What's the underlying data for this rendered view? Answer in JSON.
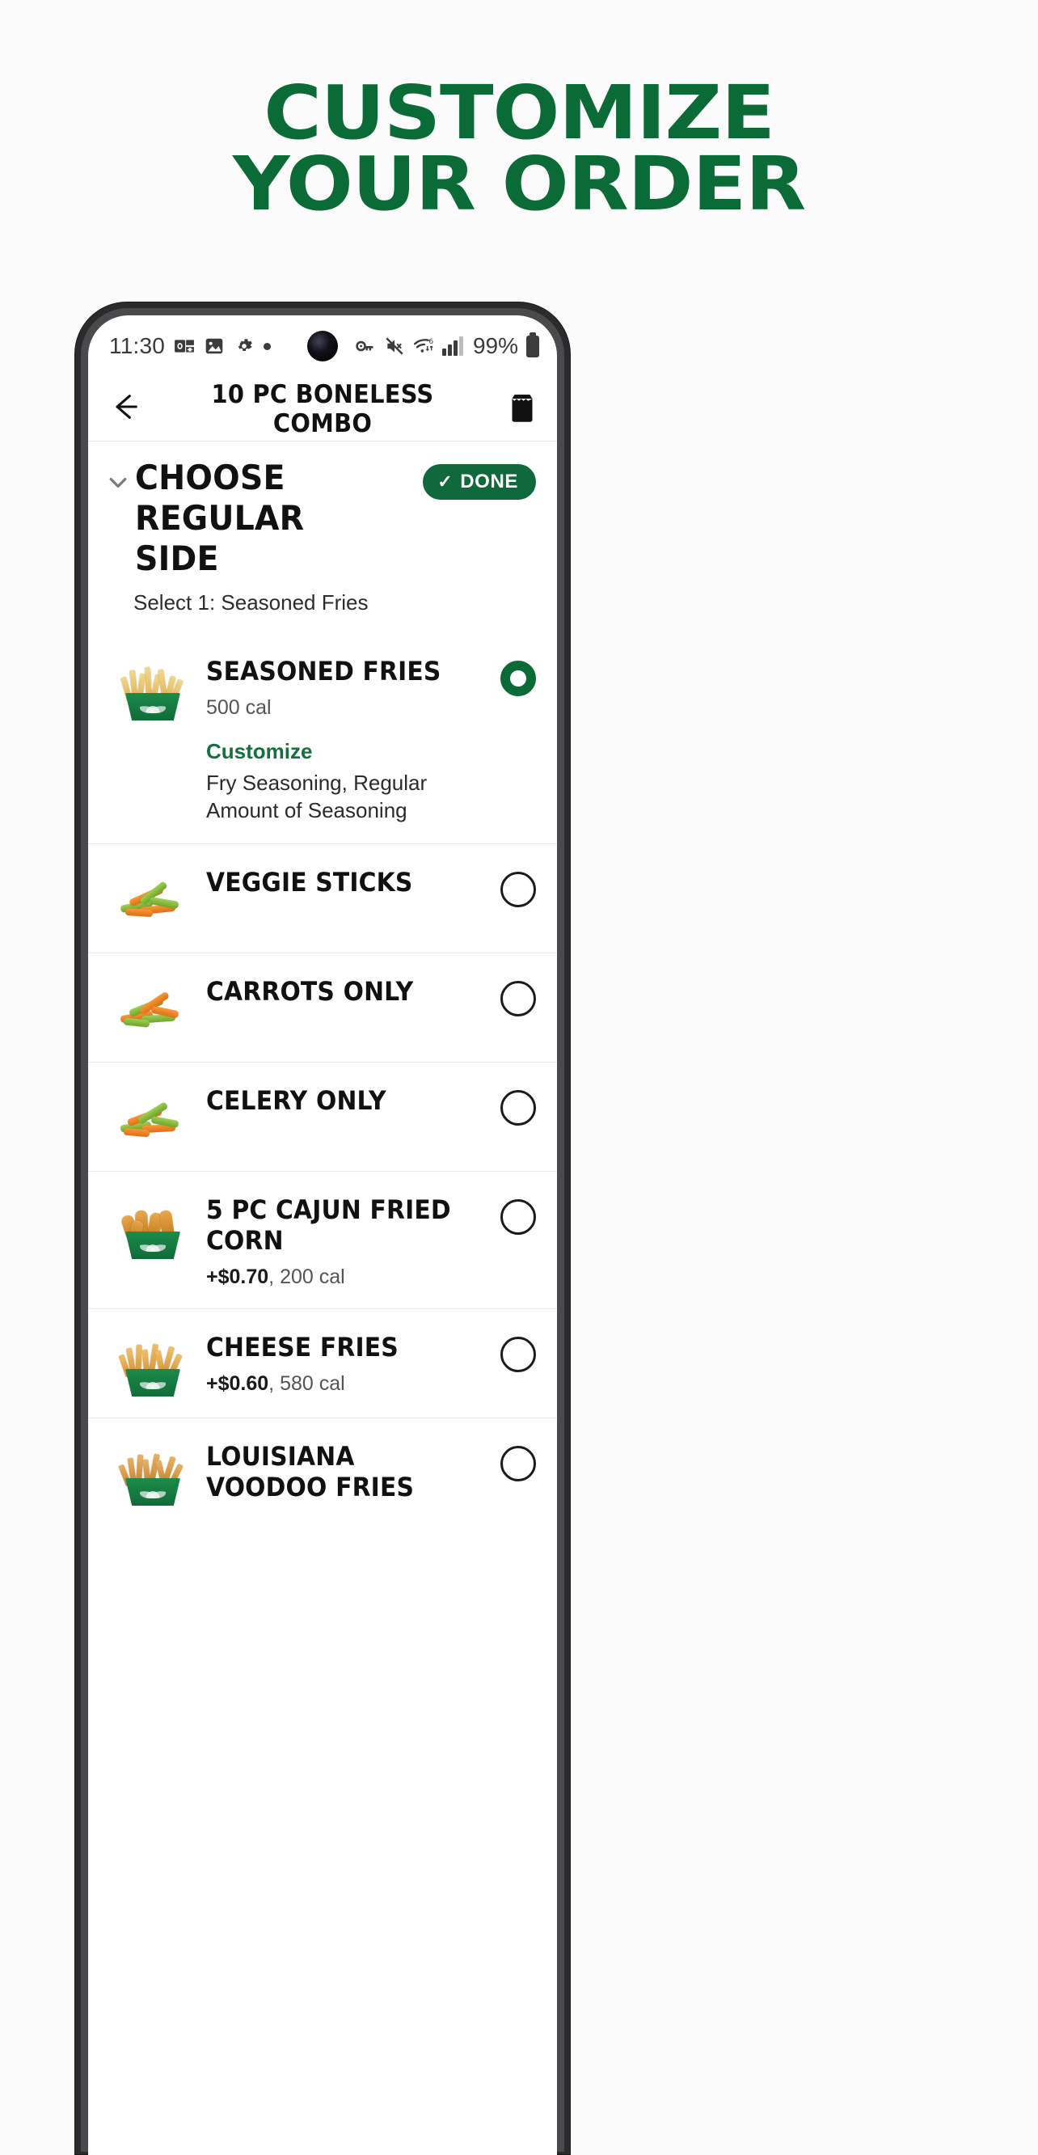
{
  "promo": {
    "line1": "CUSTOMIZE",
    "line2": "YOUR ORDER",
    "color": "#0a6b36"
  },
  "status_bar": {
    "time": "11:30",
    "icons_left": [
      "outlook-icon",
      "image-icon",
      "gear-icon",
      "dot-icon"
    ],
    "icons_right": [
      "key-icon",
      "mute-icon",
      "wifi6-icon",
      "signal-icon"
    ],
    "battery_percent": "99%"
  },
  "app_header": {
    "back_icon": "back-arrow-icon",
    "title": "10 PC BONELESS COMBO",
    "bag_icon": "shopping-bag-icon"
  },
  "section": {
    "chevron_icon": "chevron-down-icon",
    "title": "CHOOSE REGULAR SIDE",
    "done_label": "DONE",
    "done_check": "✓",
    "done_color": "#10693a",
    "select_note": "Select 1: Seasoned Fries"
  },
  "options": [
    {
      "name": "SEASONED FRIES",
      "meta_price": "",
      "meta_cal": "500 cal",
      "customize_label": "Customize",
      "customize_detail": "Fry Seasoning, Regular Amount of Seasoning",
      "selected": true,
      "thumb": "seasoned-fries-image"
    },
    {
      "name": "VEGGIE STICKS",
      "meta_price": "",
      "meta_cal": "",
      "customize_label": "",
      "customize_detail": "",
      "selected": false,
      "thumb": "veggie-sticks-image"
    },
    {
      "name": "CARROTS ONLY",
      "meta_price": "",
      "meta_cal": "",
      "customize_label": "",
      "customize_detail": "",
      "selected": false,
      "thumb": "carrots-image"
    },
    {
      "name": "CELERY ONLY",
      "meta_price": "",
      "meta_cal": "",
      "customize_label": "",
      "customize_detail": "",
      "selected": false,
      "thumb": "celery-image"
    },
    {
      "name": "5 PC CAJUN FRIED CORN",
      "meta_price": "+$0.70",
      "meta_cal": ", 200 cal",
      "customize_label": "",
      "customize_detail": "",
      "selected": false,
      "thumb": "cajun-fried-corn-image"
    },
    {
      "name": "CHEESE FRIES",
      "meta_price": "+$0.60",
      "meta_cal": ", 580 cal",
      "customize_label": "",
      "customize_detail": "",
      "selected": false,
      "thumb": "cheese-fries-image"
    },
    {
      "name": "LOUISIANA VOODOO FRIES",
      "meta_price": "",
      "meta_cal": "",
      "customize_label": "",
      "customize_detail": "",
      "selected": false,
      "thumb": "louisiana-voodoo-fries-image"
    }
  ]
}
